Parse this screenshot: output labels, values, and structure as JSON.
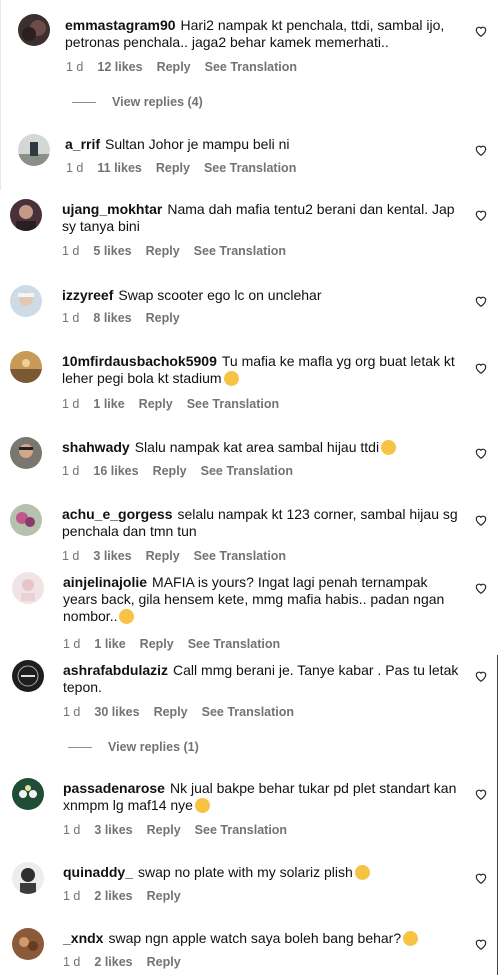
{
  "comments": [
    {
      "user": "emmastagram90",
      "text": "Hari2 nampak kt penchala, ttdi, sambal ijo, petronas penchala.. jaga2 behar kamek memerhati..",
      "age": "1 d",
      "likes": "12 likes",
      "reply": "Reply",
      "translate": "See Translation",
      "avatar_color": "#4a3a3a"
    },
    {
      "user": "a_rrif",
      "text": "Sultan Johor je mampu beli ni",
      "age": "1 d",
      "likes": "11 likes",
      "reply": "Reply",
      "translate": "See Translation",
      "avatar_color": "#b8bdb8"
    },
    {
      "user": "ujang_mokhtar",
      "text": "Nama dah mafia tentu2 berani dan kental. Jap sy tanya bini",
      "age": "1 d",
      "likes": "5 likes",
      "reply": "Reply",
      "translate": "See Translation",
      "avatar_color": "#5a4048"
    },
    {
      "user": "izzyreef",
      "text": "Swap scooter ego lc on unclehar",
      "age": "1 d",
      "likes": "8 likes",
      "reply": "Reply",
      "translate": "",
      "avatar_color": "#c9d6e2"
    },
    {
      "user": "10mfirdausbachok5909",
      "text": "Tu mafia ke mafla yg org buat letak kt leher pegi bola kt stadium",
      "age": "1 d",
      "likes": "1 like",
      "reply": "Reply",
      "translate": "See Translation",
      "avatar_color": "#b58a4e"
    },
    {
      "user": "shahwady",
      "text": "Slalu nampak kat area sambal hijau ttdi",
      "age": "1 d",
      "likes": "16 likes",
      "reply": "Reply",
      "translate": "See Translation",
      "avatar_color": "#8a7f77"
    },
    {
      "user": "achu_e_gorgess",
      "text": "selalu nampak kt 123 corner, sambal hijau sg penchala dan tmn tun",
      "age": "1 d",
      "likes": "3 likes",
      "reply": "Reply",
      "translate": "See Translation",
      "avatar_color": "#a86a8a"
    },
    {
      "user": "ainjelinajolie",
      "text": "MAFIA is yours? Ingat lagi penah ternampak years back, gila hensem kete, mmg mafia habis.. padan ngan nombor..",
      "age": "1 d",
      "likes": "1 like",
      "reply": "Reply",
      "translate": "See Translation",
      "avatar_color": "#eed9dd"
    },
    {
      "user": "ashrafabdulaziz",
      "text": "Call mmg berani je. Tanye kabar . Pas tu letak tepon.",
      "age": "1 d",
      "likes": "30 likes",
      "reply": "Reply",
      "translate": "See Translation",
      "avatar_color": "#222222"
    },
    {
      "user": "passadenarose",
      "text": "Nk jual bakpe behar tukar pd plet standart kan xnmpm lg maf14 nye",
      "age": "1 d",
      "likes": "3 likes",
      "reply": "Reply",
      "translate": "See Translation",
      "avatar_color": "#1f5a3a"
    },
    {
      "user": "quinaddy_",
      "text": "swap no plate with my solariz plish",
      "age": "1 d",
      "likes": "2 likes",
      "reply": "Reply",
      "translate": "",
      "avatar_color": "#3a3a3a"
    },
    {
      "user": "_xndx",
      "text": "swap ngn apple watch saya boleh bang behar?",
      "age": "1 d",
      "likes": "2 likes",
      "reply": "Reply",
      "translate": "",
      "avatar_color": "#8a5a3a"
    }
  ],
  "view_replies": [
    "View replies (4)",
    "View replies (1)"
  ],
  "icons": {
    "like": "heart-outline-icon",
    "avatar": "avatar-image"
  }
}
